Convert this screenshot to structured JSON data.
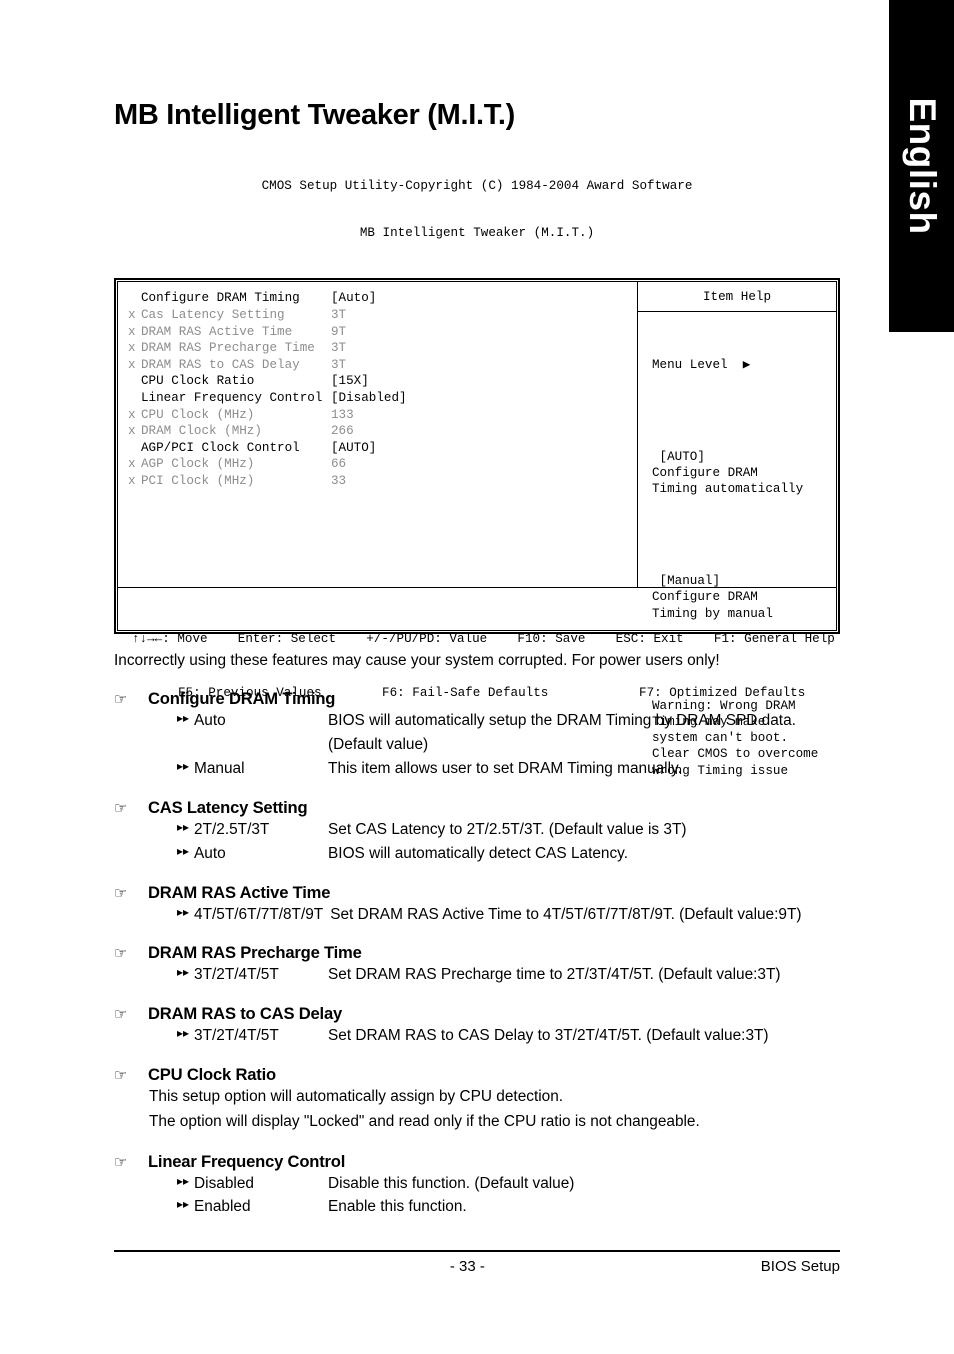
{
  "language_tab": {
    "label": "English"
  },
  "page_title": "MB Intelligent Tweaker (M.I.T.)",
  "bios": {
    "header_line1": "CMOS Setup Utility-Copyright (C) 1984-2004 Award Software",
    "header_line2": "MB Intelligent Tweaker (M.I.T.)",
    "rows": [
      {
        "mark": "",
        "label": "Configure DRAM Timing",
        "value": "[Auto]",
        "state": "active"
      },
      {
        "mark": "x",
        "label": "Cas Latency Setting",
        "value": "3T",
        "state": "dim"
      },
      {
        "mark": "x",
        "label": "DRAM RAS Active Time",
        "value": "9T",
        "state": "dim"
      },
      {
        "mark": "x",
        "label": "DRAM RAS Precharge Time",
        "value": "3T",
        "state": "dim"
      },
      {
        "mark": "x",
        "label": "DRAM RAS to CAS Delay",
        "value": "3T",
        "state": "dim"
      },
      {
        "mark": "",
        "label": "CPU Clock Ratio",
        "value": "[15X]",
        "state": "active"
      },
      {
        "mark": "",
        "label": "Linear Frequency Control",
        "value": "[Disabled]",
        "state": "active"
      },
      {
        "mark": "x",
        "label": "CPU Clock (MHz)",
        "value": "133",
        "state": "dim"
      },
      {
        "mark": "x",
        "label": "DRAM Clock (MHz)",
        "value": "266",
        "state": "dim"
      },
      {
        "mark": "",
        "label": "AGP/PCI Clock Control",
        "value": "[AUTO]",
        "state": "active"
      },
      {
        "mark": "x",
        "label": "AGP Clock (MHz)",
        "value": "66",
        "state": "dim"
      },
      {
        "mark": "x",
        "label": "PCI Clock (MHz)",
        "value": "33",
        "state": "dim"
      }
    ],
    "item_help": {
      "title": "Item Help",
      "menu_level": "Menu Level",
      "menu_level_arrow": "▶",
      "blocks": [
        " [AUTO]\nConfigure DRAM\nTiming automatically",
        " [Manual]\nConfigure DRAM\nTiming by manual",
        "Warning: Wrong DRAM\nTiming may make\nsystem can't boot.\nClear CMOS to overcome\nwrong Timing issue"
      ]
    },
    "footer_line1": "↑↓→←: Move    Enter: Select    +/-/PU/PD: Value    F10: Save    ESC: Exit    F1: General Help",
    "footer_line2": "F5: Previous Values        F6: Fail-Safe Defaults            F7: Optimized Defaults"
  },
  "note": "Incorrectly using these features may cause your system corrupted. For power users only!",
  "icons": {
    "hand": "☞",
    "chevron": "▸▸"
  },
  "sections": [
    {
      "title": "Configure DRAM Timing",
      "options": [
        {
          "name": "Auto",
          "desc": "BIOS will automatically setup the DRAM Timing by DRAM SPD data.",
          "cont": "(Default value)"
        },
        {
          "name": "Manual",
          "desc": "This item allows user to set DRAM Timing manually."
        }
      ]
    },
    {
      "title": "CAS Latency Setting",
      "options": [
        {
          "name": "2T/2.5T/3T",
          "desc": "Set CAS Latency to 2T/2.5T/3T. (Default value is 3T)"
        },
        {
          "name": "Auto",
          "desc": "BIOS will automatically detect CAS Latency."
        }
      ]
    },
    {
      "title": "DRAM RAS Active Time",
      "options": [
        {
          "name": "4T/5T/6T/7T/8T/9T",
          "wide": true,
          "desc": "Set DRAM RAS Active Time to 4T/5T/6T/7T/8T/9T. (Default value:9T)"
        }
      ]
    },
    {
      "title": "DRAM RAS Precharge Time",
      "options": [
        {
          "name": "3T/2T/4T/5T",
          "desc": "Set DRAM RAS Precharge time  to 2T/3T/4T/5T. (Default value:3T)"
        }
      ]
    },
    {
      "title": "DRAM RAS to CAS Delay",
      "options": [
        {
          "name": "3T/2T/4T/5T",
          "desc": "Set DRAM RAS to CAS Delay to 3T/2T/4T/5T. (Default value:3T)"
        }
      ]
    },
    {
      "title": "CPU Clock Ratio",
      "paragraphs": [
        "This setup option will automatically assign by CPU detection.",
        "The option will display \"Locked\" and read only if the CPU ratio is not changeable."
      ]
    },
    {
      "title": "Linear Frequency Control",
      "options": [
        {
          "name": "Disabled",
          "desc": "Disable this function. (Default value)"
        },
        {
          "name": "Enabled",
          "desc": "Enable this function."
        }
      ]
    }
  ],
  "footer": {
    "page_number": "- 33 -",
    "section_label": "BIOS Setup"
  }
}
